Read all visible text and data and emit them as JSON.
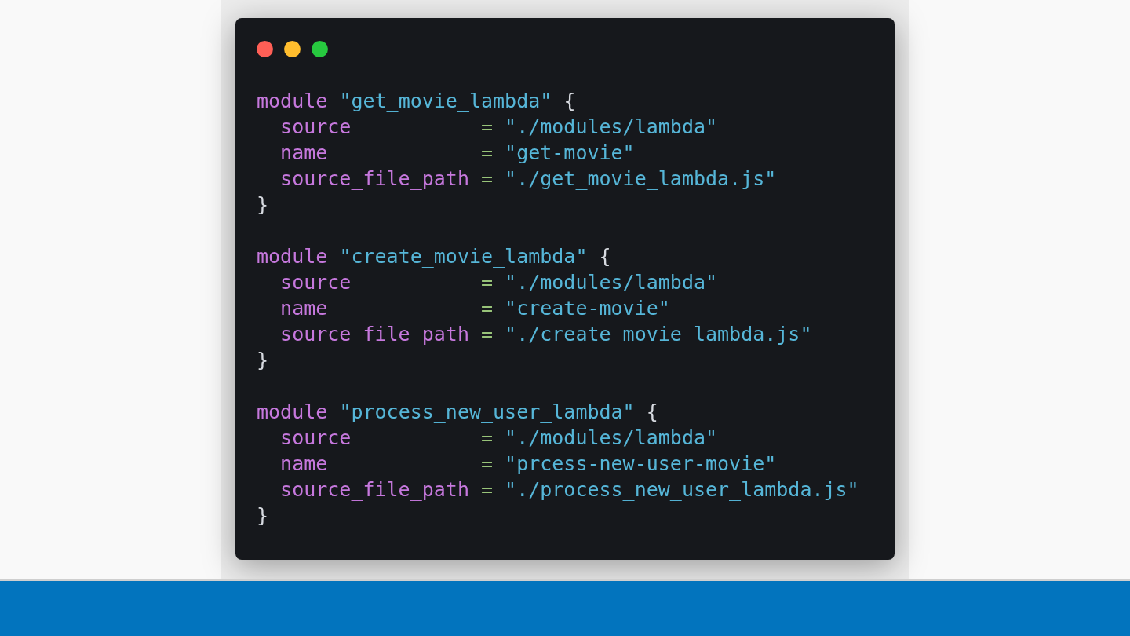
{
  "window": {
    "controls": [
      {
        "color": "#ff5f56"
      },
      {
        "color": "#ffbd2e"
      },
      {
        "color": "#27c93f"
      }
    ]
  },
  "modules": [
    {
      "keyword": "module",
      "name": "\"get_movie_lambda\"",
      "open": "{",
      "close": "}",
      "attributes": [
        {
          "key": "source",
          "operator": "=",
          "value": "\"./modules/lambda\""
        },
        {
          "key": "name",
          "operator": "=",
          "value": "\"get-movie\""
        },
        {
          "key": "source_file_path",
          "operator": "=",
          "value": "\"./get_movie_lambda.js\""
        }
      ]
    },
    {
      "keyword": "module",
      "name": "\"create_movie_lambda\"",
      "open": "{",
      "close": "}",
      "attributes": [
        {
          "key": "source",
          "operator": "=",
          "value": "\"./modules/lambda\""
        },
        {
          "key": "name",
          "operator": "=",
          "value": "\"create-movie\""
        },
        {
          "key": "source_file_path",
          "operator": "=",
          "value": "\"./create_movie_lambda.js\""
        }
      ]
    },
    {
      "keyword": "module",
      "name": "\"process_new_user_lambda\"",
      "open": "{",
      "close": "}",
      "attributes": [
        {
          "key": "source",
          "operator": "=",
          "value": "\"./modules/lambda\""
        },
        {
          "key": "name",
          "operator": "=",
          "value": "\"prcess-new-user-movie\""
        },
        {
          "key": "source_file_path",
          "operator": "=",
          "value": "\"./process_new_user_lambda.js\""
        }
      ]
    }
  ]
}
